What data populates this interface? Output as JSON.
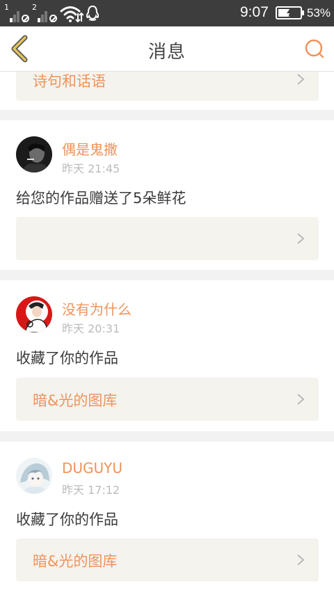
{
  "status_bar": {
    "sim1_label": "1",
    "sim2_label": "2",
    "time": "9:07",
    "battery_percent": "53%",
    "battery_level": 0.53,
    "icons": [
      "signal-icon",
      "no-service-icon",
      "wifi-icon",
      "qq-icon",
      "battery-charging-icon"
    ]
  },
  "header": {
    "title": "消息",
    "back_icon": "chevron-left-icon",
    "search_icon": "search-icon"
  },
  "colors": {
    "accent": "#f0935a",
    "back_accent": "#e3c45a",
    "statusbar": "#3d3d3d",
    "link_box": "#f4f3ee"
  },
  "partial_item": {
    "link_text": "诗句和话语"
  },
  "messages": [
    {
      "username": "偶是鬼撒",
      "time": "昨天 21:45",
      "action": "给您的作品赠送了5朵鲜花",
      "link_text": ""
    },
    {
      "username": "没有为什么",
      "time": "昨天 20:31",
      "action": "收藏了你的作品",
      "link_text": "暗&光的图库"
    },
    {
      "username": "DUGUYU",
      "time": "昨天 17:12",
      "action": "收藏了你的作品",
      "link_text": "暗&光的图库"
    }
  ]
}
